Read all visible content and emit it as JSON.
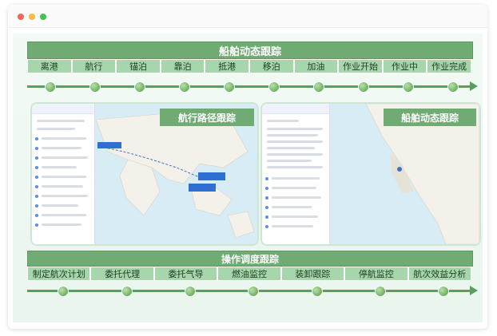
{
  "header": {
    "title": "船舶动态跟踪"
  },
  "stages": [
    "离港",
    "航行",
    "锚泊",
    "靠泊",
    "抵港",
    "移泊",
    "加油",
    "作业开始",
    "作业中",
    "作业完成"
  ],
  "panels": {
    "left_title": "航行路径跟踪",
    "right_title": "船舶动态跟踪"
  },
  "ops": {
    "title": "操作调度跟踪",
    "stages": [
      "制定航次计划",
      "委托代理",
      "委托气导",
      "燃油监控",
      "装卸跟踪",
      "停航监控",
      "航次效益分析"
    ]
  },
  "colors": {
    "accent": "#6fab73",
    "stage_bg": "#a7d6ad",
    "timeline": "#53a25e",
    "sea": "#d8ecf6",
    "land": "#f3f1ea"
  }
}
